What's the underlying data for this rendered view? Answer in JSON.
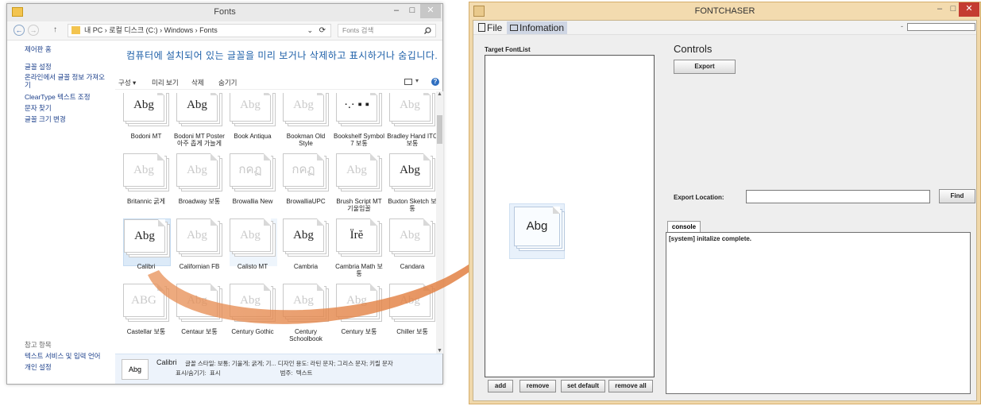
{
  "left_window": {
    "title": "Fonts",
    "controls": {
      "minimize": "–",
      "maximize": "□",
      "close": "✕"
    },
    "address": {
      "back": "←",
      "forward": "→",
      "up": "↑",
      "path": "내 PC  ›  로컬 디스크 (C:)  ›  Windows  ›  Fonts",
      "refresh": "⟳",
      "dropdown": "⌄"
    },
    "search_placeholder": "Fonts 검색",
    "sidebar": {
      "top_links": [
        "제어판 홈",
        "글꼴 설정",
        "온라인에서 글꼴 정보 가져오기",
        "ClearType 텍스트 조정",
        "문자 찾기",
        "글꼴 크기 변경"
      ],
      "see_also": "참고 항목",
      "bottom_links": [
        "텍스트 서비스 및 입력 언어",
        "개인 설정"
      ]
    },
    "heading": "컴퓨터에 설치되어 있는 글꼴을 미리 보거나 삭제하고 표시하거나 숨깁니다.",
    "toolbar": {
      "organize": "구성 ▾",
      "preview": "미리 보기",
      "delete": "삭제",
      "hide": "숨기기"
    },
    "fonts": [
      {
        "name": "Bodoni MT",
        "sample": "Abg",
        "dim": false
      },
      {
        "name": "Bodoni MT Poster 아주 좁게 가늘게",
        "sample": "Abg",
        "dim": false
      },
      {
        "name": "Book Antiqua",
        "sample": "Abg",
        "dim": true
      },
      {
        "name": "Bookman Old Style",
        "sample": "Abg",
        "dim": true
      },
      {
        "name": "Bookshelf Symbol 7 보통",
        "sample": "·.· ▪ ▪",
        "dim": false
      },
      {
        "name": "Bradley Hand ITC 보통",
        "sample": "Abg",
        "dim": true
      },
      {
        "name": "Britannic 굵게",
        "sample": "Abg",
        "dim": true
      },
      {
        "name": "Broadway 보통",
        "sample": "Abg",
        "dim": true
      },
      {
        "name": "Browallia New",
        "sample": "กคฏ",
        "dim": true
      },
      {
        "name": "BrowalliaUPC",
        "sample": "กคฏ",
        "dim": true
      },
      {
        "name": "Brush Script MT 기울임꼴",
        "sample": "Abg",
        "dim": true
      },
      {
        "name": "Buxton Sketch 보통",
        "sample": "Abg",
        "dim": false
      },
      {
        "name": "Calibri",
        "sample": "Abg",
        "dim": false
      },
      {
        "name": "Californian FB",
        "sample": "Abg",
        "dim": true
      },
      {
        "name": "Calisto MT",
        "sample": "Abg",
        "dim": true
      },
      {
        "name": "Cambria",
        "sample": "Abg",
        "dim": false
      },
      {
        "name": "Cambria Math 보통",
        "sample": "Ïrĕ",
        "dim": false
      },
      {
        "name": "Candara",
        "sample": "Abg",
        "dim": true
      },
      {
        "name": "Castellar 보통",
        "sample": "ABG",
        "dim": true
      },
      {
        "name": "Centaur 보통",
        "sample": "Abg",
        "dim": true
      },
      {
        "name": "Century Gothic",
        "sample": "Abg",
        "dim": true
      },
      {
        "name": "Century Schoolbook",
        "sample": "Abg",
        "dim": true
      },
      {
        "name": "Century 보통",
        "sample": "Abg",
        "dim": true
      },
      {
        "name": "Chiller 보통",
        "sample": "Abg",
        "dim": true
      }
    ],
    "details": {
      "font_name": "Calibri",
      "line1": "글꼴 스타일:  보통; 기울게; 굵게; 기... 디자인 용도:  라틴 문자; 그리스 문자; 키릴 문자",
      "line2": "표시/숨기기:  표시                                    범주:  텍스트",
      "sample": "Abg"
    }
  },
  "right_window": {
    "title": "FONTCHASER",
    "controls": {
      "minimize": "–",
      "maximize": "□",
      "close": "✕"
    },
    "menu": {
      "file": "File",
      "info": "Infomation",
      "dash": "-"
    },
    "target_label": "Target FontList",
    "list_buttons": {
      "add": "add",
      "remove": "remove",
      "set_default": "set default",
      "remove_all": "remove all"
    },
    "controls_heading": "Controls",
    "export_button": "Export",
    "export_location_label": "Export Location:",
    "export_location_value": "",
    "find_button": "Find",
    "console_tab": "console",
    "console_text": "[system] initalize complete.",
    "drag_sample": "Abg"
  },
  "colors": {
    "arrow": "#e8925a",
    "link": "#1a3e8a",
    "heading": "#1d5fa8",
    "frame": "#f0d8aa",
    "close_red": "#c43c32"
  }
}
